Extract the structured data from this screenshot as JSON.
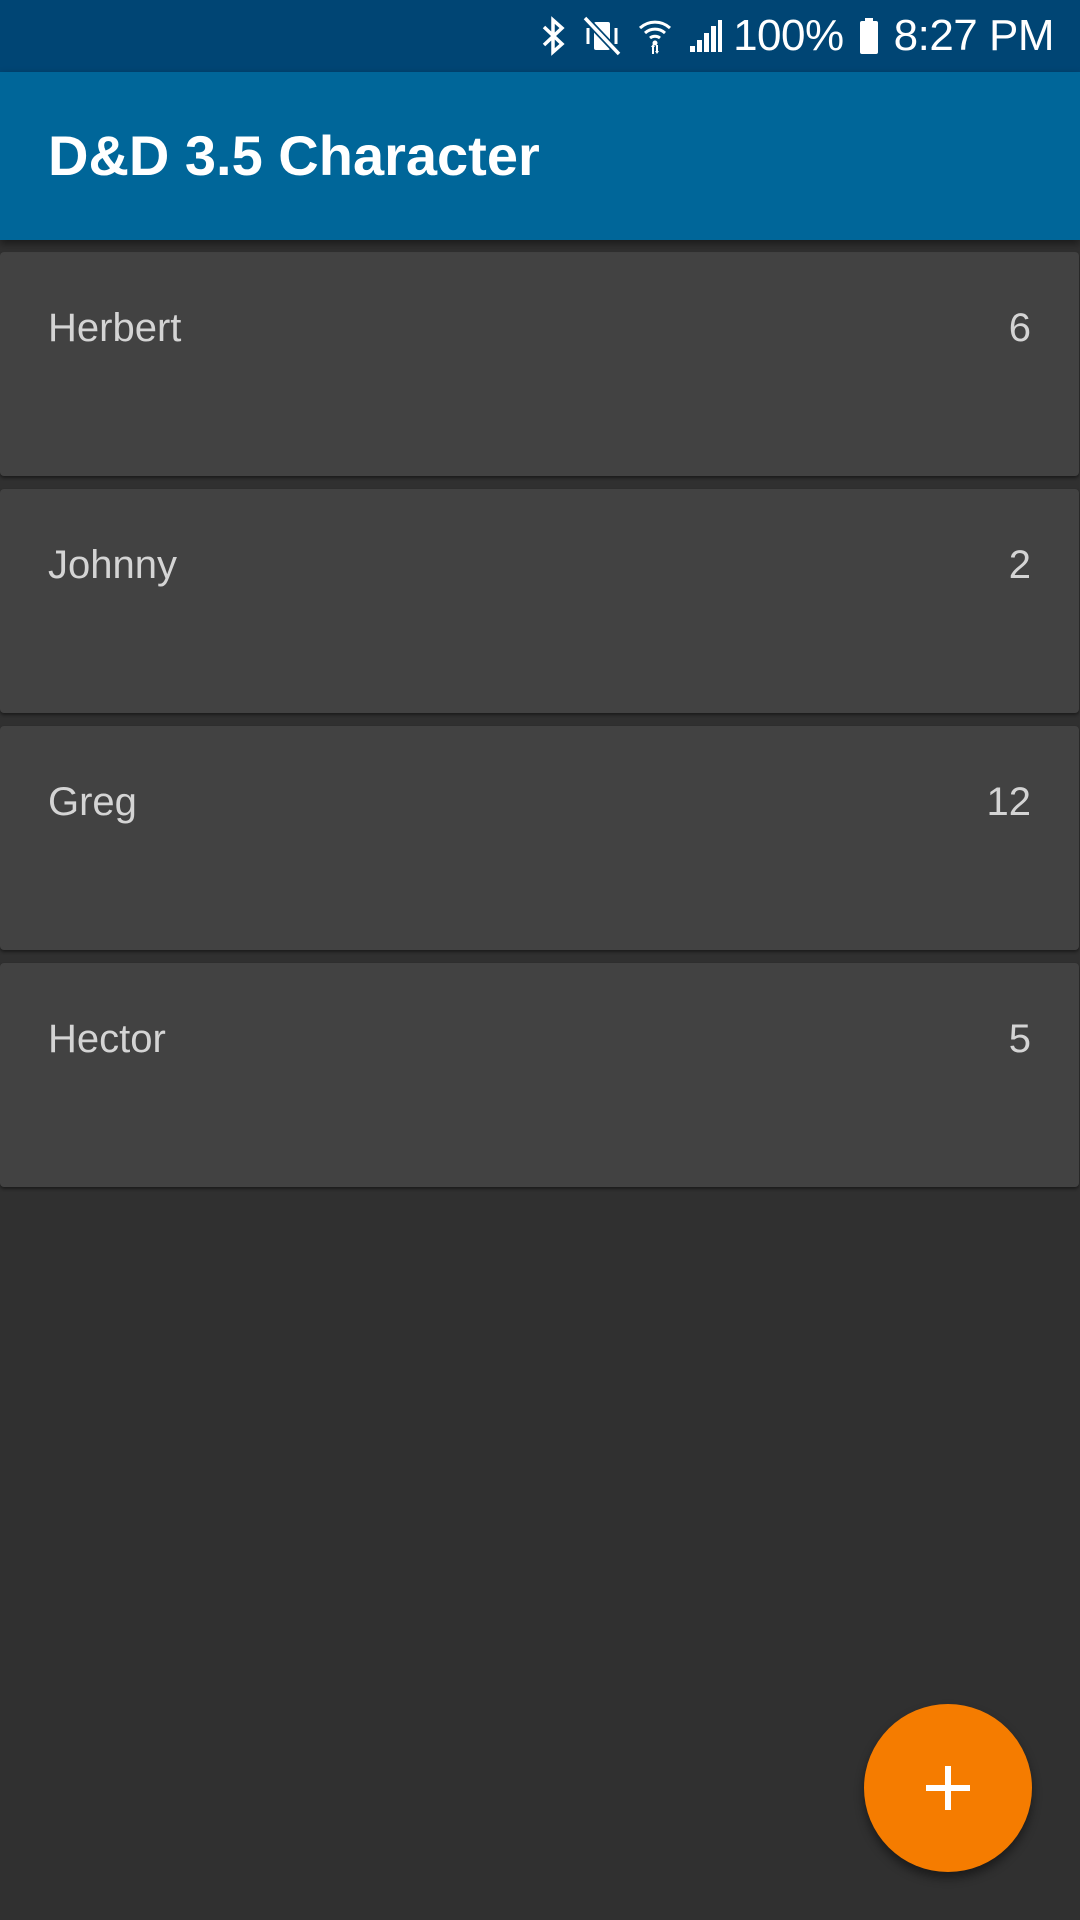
{
  "status_bar": {
    "battery": "100%",
    "time": "8:27 PM",
    "icons": [
      "bluetooth-icon",
      "vibrate-mute-icon",
      "wifi-icon",
      "signal-icon",
      "battery-icon"
    ]
  },
  "app_bar": {
    "title": "D&D 3.5 Character"
  },
  "characters": [
    {
      "name": "Herbert",
      "level": "6"
    },
    {
      "name": "Johnny",
      "level": "2"
    },
    {
      "name": "Greg",
      "level": "12"
    },
    {
      "name": "Hector",
      "level": "5"
    }
  ],
  "fab": {
    "icon": "plus-icon",
    "color": "#f57c00"
  },
  "colors": {
    "status_bar": "#004574",
    "app_bar": "#006699",
    "background": "#303030",
    "card": "#424242",
    "accent": "#f57c00"
  }
}
